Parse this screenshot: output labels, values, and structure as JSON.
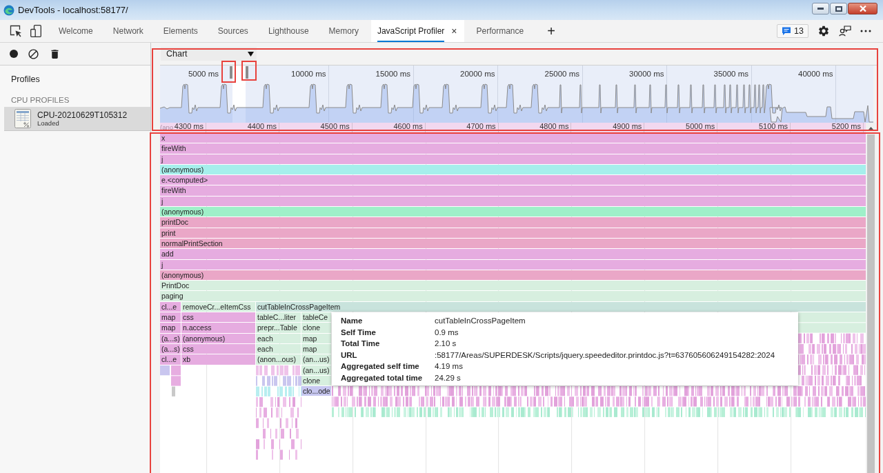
{
  "window": {
    "title": "DevTools - localhost:58177/"
  },
  "tabs": [
    {
      "label": "Welcome",
      "selected": false
    },
    {
      "label": "Network",
      "selected": false
    },
    {
      "label": "Elements",
      "selected": false
    },
    {
      "label": "Sources",
      "selected": false
    },
    {
      "label": "Lighthouse",
      "selected": false
    },
    {
      "label": "Memory",
      "selected": false
    },
    {
      "label": "JavaScript Profiler",
      "selected": true,
      "close": "×"
    },
    {
      "label": "Performance",
      "selected": false
    }
  ],
  "add_tab": "+",
  "issues": {
    "count": "13"
  },
  "sidebar": {
    "title": "Profiles",
    "section": "CPU PROFILES",
    "profiles": [
      {
        "name": "CPU-20210629T105312",
        "status": "Loaded",
        "selected": true
      }
    ]
  },
  "view_select": {
    "value": "Chart"
  },
  "overview": {
    "ticks": [
      "5000 ms",
      "10000 ms",
      "15000 ms",
      "20000 ms",
      "25000 ms",
      "30000 ms",
      "35000 ms",
      "40000 ms"
    ]
  },
  "flame_chart": {
    "ruler_underlay": "(ano",
    "ruler": [
      "4300 ms",
      "4400 ms",
      "4500 ms",
      "4600 ms",
      "4700 ms",
      "4800 ms",
      "4900 ms",
      "5000 ms",
      "5100 ms",
      "5200 ms"
    ],
    "rows": [
      {
        "cells": [
          {
            "label": "x",
            "color": "#e6ace0"
          }
        ]
      },
      {
        "cells": [
          {
            "label": "fireWith",
            "color": "#e6ace0"
          }
        ]
      },
      {
        "cells": [
          {
            "label": "j",
            "color": "#e6ace0"
          }
        ]
      },
      {
        "cells": [
          {
            "label": "(anonymous)",
            "color": "#a6efec"
          }
        ]
      },
      {
        "cells": [
          {
            "label": "e.<computed>",
            "color": "#e6ace0"
          }
        ]
      },
      {
        "cells": [
          {
            "label": "fireWith",
            "color": "#e6ace0"
          }
        ]
      },
      {
        "cells": [
          {
            "label": "j",
            "color": "#e6ace0"
          }
        ]
      },
      {
        "cells": [
          {
            "label": "(anonymous)",
            "color": "#9ff0c9"
          }
        ]
      },
      {
        "cells": [
          {
            "label": "printDoc",
            "color": "#eaa7c7"
          }
        ]
      },
      {
        "cells": [
          {
            "label": "print",
            "color": "#eaa7c7"
          }
        ]
      },
      {
        "cells": [
          {
            "label": "normalPrintSection",
            "color": "#eaa7c7"
          }
        ]
      },
      {
        "cells": [
          {
            "label": "add",
            "color": "#e6ace0"
          }
        ]
      },
      {
        "cells": [
          {
            "label": "j",
            "color": "#e6ace0"
          }
        ]
      },
      {
        "cells": [
          {
            "label": "(anonymous)",
            "color": "#eaa7c7"
          }
        ]
      },
      {
        "cells": [
          {
            "label": "PrintDoc",
            "color": "#d7efdf"
          }
        ]
      },
      {
        "cells": [
          {
            "label": "paging",
            "color": "#d7efdf"
          }
        ]
      },
      {
        "cells": [
          {
            "label": "cl...e",
            "color": "#e6ace0"
          },
          {
            "label": "removeCr...eItemCss",
            "color": "#d7efdf"
          },
          {
            "label": "cutTableInCrossPageItem",
            "color": "#c8e3dc"
          }
        ]
      },
      {
        "cells": [
          {
            "label": "map",
            "color": "#e6ace0"
          },
          {
            "label": "css",
            "color": "#e6ace0"
          },
          {
            "label": "tableC...liter",
            "color": "#d7efdf"
          },
          {
            "label": "tableCe",
            "color": "#d7efdf"
          }
        ]
      },
      {
        "cells": [
          {
            "label": "map",
            "color": "#e6ace0"
          },
          {
            "label": "n.access",
            "color": "#e6ace0"
          },
          {
            "label": "prepr...Table",
            "color": "#d7efdf"
          },
          {
            "label": "clone",
            "color": "#d7efdf"
          }
        ]
      },
      {
        "cells": [
          {
            "label": "(a...s)",
            "color": "#e6ace0"
          },
          {
            "label": "(anonymous)",
            "color": "#e6ace0"
          },
          {
            "label": "each",
            "color": "#d7efdf"
          },
          {
            "label": "map",
            "color": "#d7efdf"
          }
        ]
      },
      {
        "cells": [
          {
            "label": "(a...s)",
            "color": "#e6ace0"
          },
          {
            "label": "css",
            "color": "#e6ace0"
          },
          {
            "label": "each",
            "color": "#d7efdf"
          },
          {
            "label": "map",
            "color": "#d7efdf"
          }
        ]
      },
      {
        "cells": [
          {
            "label": "cl...e",
            "color": "#e6ace0"
          },
          {
            "label": "xb",
            "color": "#e6ace0"
          },
          {
            "label": "(anon...ous)",
            "color": "#d7efdf"
          },
          {
            "label": "(an...us)",
            "color": "#d7efdf"
          }
        ]
      },
      {
        "cells": [
          {
            "label": "(an...us)",
            "color": "#d7efdf"
          }
        ]
      },
      {
        "cells": [
          {
            "label": "clone",
            "color": "#d7efdf"
          }
        ]
      },
      {
        "cells": [
          {
            "label": "clo...ode",
            "color": "#c7c7f0"
          }
        ]
      }
    ]
  },
  "tooltip": {
    "rows": [
      {
        "label": "Name",
        "value": "cutTableInCrossPageItem"
      },
      {
        "label": "Self Time",
        "value": "0.9 ms"
      },
      {
        "label": "Total Time",
        "value": "2.10 s"
      },
      {
        "label": "URL",
        "value": ":58177/Areas/SUPERDESK/Scripts/jquery.speededitor.printdoc.js?t=637605606249154282:2024"
      },
      {
        "label": "Aggregated self time",
        "value": "4.19 ms"
      },
      {
        "label": "Aggregated total time",
        "value": "24.29 s"
      }
    ]
  }
}
